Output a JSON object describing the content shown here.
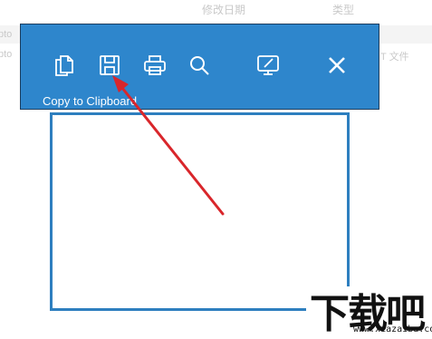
{
  "background_window": {
    "columns": {
      "date_modified": "修改日期",
      "type": "类型"
    },
    "rows": [
      {
        "name": "pto",
        "type": ""
      },
      {
        "name": "pto",
        "type": "T 文件"
      }
    ]
  },
  "toolbar": {
    "tooltip": "Copy to Clipboard",
    "buttons": [
      {
        "id": "copy",
        "icon": "copy-icon"
      },
      {
        "id": "save",
        "icon": "save-icon"
      },
      {
        "id": "print",
        "icon": "print-icon"
      },
      {
        "id": "search",
        "icon": "search-icon"
      },
      {
        "id": "edit",
        "icon": "edit-screen-icon"
      },
      {
        "id": "close",
        "icon": "close-icon"
      }
    ],
    "colors": {
      "bar": "#2e86cc",
      "icon": "#ffffff"
    }
  },
  "annotation": {
    "arrow_color": "#d9262b"
  },
  "watermark": {
    "text": "下载吧",
    "url": "www.xiazaiba.com"
  }
}
